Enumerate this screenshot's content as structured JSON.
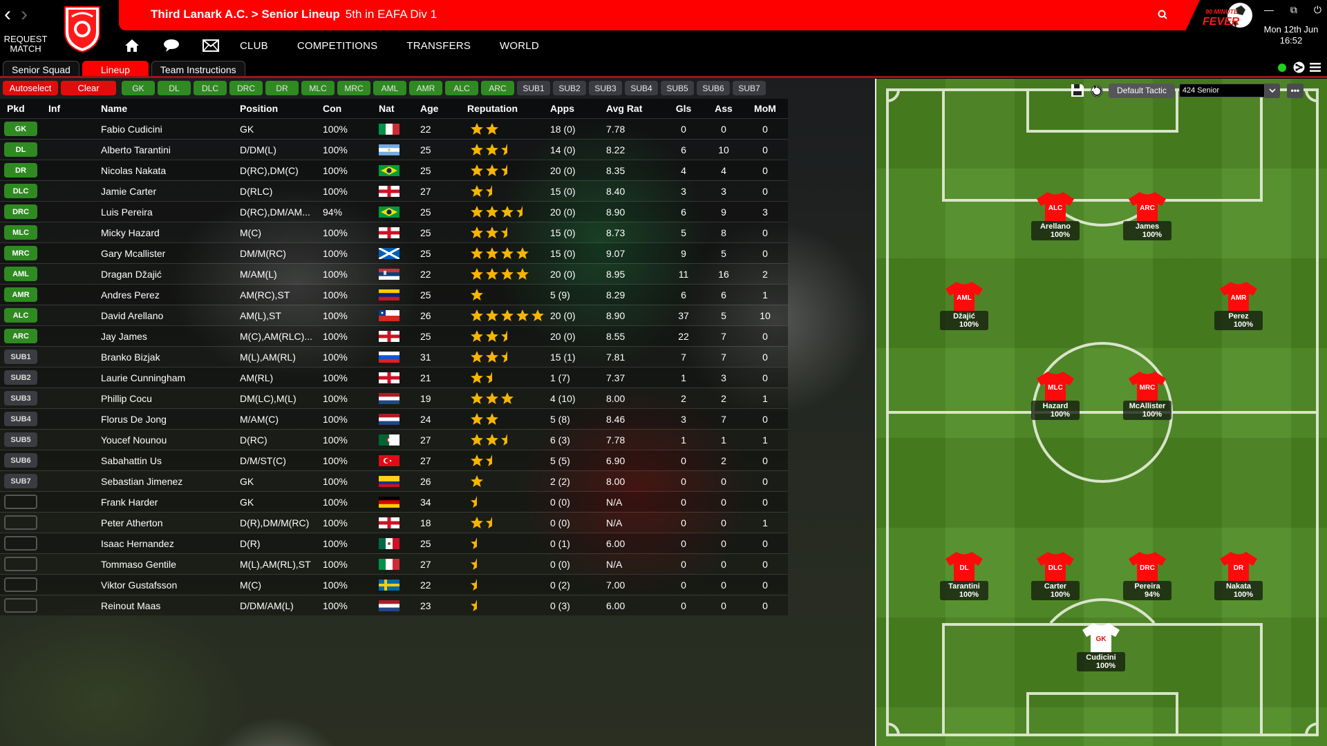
{
  "window": {
    "title_path": "Third Lanark A.C. > Senior Lineup",
    "title_sub": "5th in EAFA Div 1",
    "date": "Mon 12th Jun",
    "time": "16:52",
    "request_match": "REQUEST MATCH",
    "brand": "90 MINUTE FEVER"
  },
  "main_nav": [
    "CLUB",
    "COMPETITIONS",
    "TRANSFERS",
    "WORLD"
  ],
  "sub_tabs": [
    {
      "label": "Senior Squad",
      "active": false
    },
    {
      "label": "Lineup",
      "active": true
    },
    {
      "label": "Team Instructions",
      "active": false
    }
  ],
  "actions": {
    "autoselect": "Autoselect",
    "clear": "Clear"
  },
  "position_slots": {
    "starting": [
      "GK",
      "DL",
      "DLC",
      "DRC",
      "DR",
      "MLC",
      "MRC",
      "AML",
      "AMR",
      "ALC",
      "ARC"
    ],
    "subs": [
      "SUB1",
      "SUB2",
      "SUB3",
      "SUB4",
      "SUB5",
      "SUB6",
      "SUB7"
    ]
  },
  "table": {
    "headers": [
      "Pkd",
      "Inf",
      "Name",
      "Position",
      "Con",
      "Nat",
      "Age",
      "Reputation",
      "Apps",
      "Avg Rat",
      "Gls",
      "Ass",
      "MoM"
    ],
    "rows": [
      {
        "pkd": "GK",
        "name": "Fabio Cudicini",
        "position": "GK",
        "con": "100%",
        "nat": "italy",
        "age": "22",
        "rep": 2,
        "apps": "18 (0)",
        "avg": "7.78",
        "gls": "0",
        "ass": "0",
        "mom": "0"
      },
      {
        "pkd": "DL",
        "name": "Alberto Tarantini",
        "position": "D/DM(L)",
        "con": "100%",
        "nat": "argentina",
        "age": "25",
        "rep": 2.5,
        "apps": "14 (0)",
        "avg": "8.22",
        "gls": "6",
        "ass": "10",
        "mom": "0"
      },
      {
        "pkd": "DR",
        "name": "Nicolas Nakata",
        "position": "D(RC),DM(C)",
        "con": "100%",
        "nat": "brazil",
        "age": "25",
        "rep": 2.5,
        "apps": "20 (0)",
        "avg": "8.35",
        "gls": "4",
        "ass": "4",
        "mom": "0"
      },
      {
        "pkd": "DLC",
        "name": "Jamie Carter",
        "position": "D(RLC)",
        "con": "100%",
        "nat": "england",
        "age": "27",
        "rep": 1.5,
        "apps": "15 (0)",
        "avg": "8.40",
        "gls": "3",
        "ass": "3",
        "mom": "0"
      },
      {
        "pkd": "DRC",
        "name": "Luis Pereira",
        "position": "D(RC),DM/AM...",
        "con": "94%",
        "nat": "brazil",
        "age": "25",
        "rep": 3.5,
        "apps": "20 (0)",
        "avg": "8.90",
        "gls": "6",
        "ass": "9",
        "mom": "3"
      },
      {
        "pkd": "MLC",
        "name": "Micky Hazard",
        "position": "M(C)",
        "con": "100%",
        "nat": "england",
        "age": "25",
        "rep": 2.5,
        "apps": "15 (0)",
        "avg": "8.73",
        "gls": "5",
        "ass": "8",
        "mom": "0"
      },
      {
        "pkd": "MRC",
        "name": "Gary Mcallister",
        "position": "DM/M(RC)",
        "con": "100%",
        "nat": "scotland",
        "age": "25",
        "rep": 4,
        "apps": "15 (0)",
        "avg": "9.07",
        "gls": "9",
        "ass": "5",
        "mom": "0"
      },
      {
        "pkd": "AML",
        "name": "Dragan Džajić",
        "position": "M/AM(L)",
        "con": "100%",
        "nat": "serbia",
        "age": "22",
        "rep": 4,
        "apps": "20 (0)",
        "avg": "8.95",
        "gls": "11",
        "ass": "16",
        "mom": "2"
      },
      {
        "pkd": "AMR",
        "name": "Andres Perez",
        "position": "AM(RC),ST",
        "con": "100%",
        "nat": "venezuela",
        "age": "25",
        "rep": 1,
        "apps": "5 (9)",
        "avg": "8.29",
        "gls": "6",
        "ass": "6",
        "mom": "1"
      },
      {
        "pkd": "ALC",
        "name": "David Arellano",
        "position": "AM(L),ST",
        "con": "100%",
        "nat": "chile",
        "age": "26",
        "rep": 5,
        "apps": "20 (0)",
        "avg": "8.90",
        "gls": "37",
        "ass": "5",
        "mom": "10"
      },
      {
        "pkd": "ARC",
        "name": "Jay James",
        "position": "M(C),AM(RLC)...",
        "con": "100%",
        "nat": "england",
        "age": "25",
        "rep": 2.5,
        "apps": "20 (0)",
        "avg": "8.55",
        "gls": "22",
        "ass": "7",
        "mom": "0"
      },
      {
        "pkd": "SUB1",
        "name": "Branko Bizjak",
        "position": "M(L),AM(RL)",
        "con": "100%",
        "nat": "slovenia",
        "age": "31",
        "rep": 2.5,
        "apps": "15 (1)",
        "avg": "7.81",
        "gls": "7",
        "ass": "7",
        "mom": "0"
      },
      {
        "pkd": "SUB2",
        "name": "Laurie Cunningham",
        "position": "AM(RL)",
        "con": "100%",
        "nat": "england",
        "age": "21",
        "rep": 1.5,
        "apps": "1 (7)",
        "avg": "7.37",
        "gls": "1",
        "ass": "3",
        "mom": "0"
      },
      {
        "pkd": "SUB3",
        "name": "Phillip Cocu",
        "position": "DM(LC),M(L)",
        "con": "100%",
        "nat": "netherlands",
        "age": "19",
        "rep": 3,
        "apps": "4 (10)",
        "avg": "8.00",
        "gls": "2",
        "ass": "2",
        "mom": "1"
      },
      {
        "pkd": "SUB4",
        "name": "Florus De Jong",
        "position": "M/AM(C)",
        "con": "100%",
        "nat": "netherlands",
        "age": "24",
        "rep": 2,
        "apps": "5 (8)",
        "avg": "8.46",
        "gls": "3",
        "ass": "7",
        "mom": "0"
      },
      {
        "pkd": "SUB5",
        "name": "Youcef Nounou",
        "position": "D(RC)",
        "con": "100%",
        "nat": "algeria",
        "age": "27",
        "rep": 2.5,
        "apps": "6 (3)",
        "avg": "7.78",
        "gls": "1",
        "ass": "1",
        "mom": "1"
      },
      {
        "pkd": "SUB6",
        "name": "Sabahattin Us",
        "position": "D/M/ST(C)",
        "con": "100%",
        "nat": "turkey",
        "age": "27",
        "rep": 1.5,
        "apps": "5 (5)",
        "avg": "6.90",
        "gls": "0",
        "ass": "2",
        "mom": "0"
      },
      {
        "pkd": "SUB7",
        "name": "Sebastian Jimenez",
        "position": "GK",
        "con": "100%",
        "nat": "colombia",
        "age": "26",
        "rep": 1,
        "apps": "2 (2)",
        "avg": "8.00",
        "gls": "0",
        "ass": "0",
        "mom": "0"
      },
      {
        "pkd": "",
        "name": "Frank Harder",
        "position": "GK",
        "con": "100%",
        "nat": "germany",
        "age": "34",
        "rep": 0.5,
        "apps": "0 (0)",
        "avg": "N/A",
        "gls": "0",
        "ass": "0",
        "mom": "0"
      },
      {
        "pkd": "",
        "name": "Peter Atherton",
        "position": "D(R),DM/M(RC)",
        "con": "100%",
        "nat": "england",
        "age": "18",
        "rep": 1.5,
        "apps": "0 (0)",
        "avg": "N/A",
        "gls": "0",
        "ass": "0",
        "mom": "1"
      },
      {
        "pkd": "",
        "name": "Isaac Hernandez",
        "position": "D(R)",
        "con": "100%",
        "nat": "mexico",
        "age": "25",
        "rep": 0.5,
        "apps": "0 (1)",
        "avg": "6.00",
        "gls": "0",
        "ass": "0",
        "mom": "0"
      },
      {
        "pkd": "",
        "name": "Tommaso Gentile",
        "position": "M(L),AM(RL),ST",
        "con": "100%",
        "nat": "italy",
        "age": "27",
        "rep": 0.5,
        "apps": "0 (0)",
        "avg": "N/A",
        "gls": "0",
        "ass": "0",
        "mom": "0"
      },
      {
        "pkd": "",
        "name": "Viktor Gustafsson",
        "position": "M(C)",
        "con": "100%",
        "nat": "sweden",
        "age": "22",
        "rep": 0.5,
        "apps": "0 (2)",
        "avg": "7.00",
        "gls": "0",
        "ass": "0",
        "mom": "0"
      },
      {
        "pkd": "",
        "name": "Reinout Maas",
        "position": "D/DM/AM(L)",
        "con": "100%",
        "nat": "netherlands",
        "age": "23",
        "rep": 0.5,
        "apps": "0 (3)",
        "avg": "6.00",
        "gls": "0",
        "ass": "0",
        "mom": "0"
      }
    ]
  },
  "tactic": {
    "default_label": "Default Tactic",
    "selected": "424 Senior"
  },
  "pitch_players": [
    {
      "slot": "ALC",
      "name": "Arellano",
      "pct": "100%"
    },
    {
      "slot": "ARC",
      "name": "James",
      "pct": "100%"
    },
    {
      "slot": "AML",
      "name": "Džajić",
      "pct": "100%"
    },
    {
      "slot": "AMR",
      "name": "Perez",
      "pct": "100%"
    },
    {
      "slot": "MLC",
      "name": "Hazard",
      "pct": "100%"
    },
    {
      "slot": "MRC",
      "name": "McAllister",
      "pct": "100%"
    },
    {
      "slot": "DL",
      "name": "Tarantini",
      "pct": "100%"
    },
    {
      "slot": "DLC",
      "name": "Carter",
      "pct": "100%"
    },
    {
      "slot": "DRC",
      "name": "Pereira",
      "pct": "94%"
    },
    {
      "slot": "DR",
      "name": "Nakata",
      "pct": "100%"
    },
    {
      "slot": "GK",
      "name": "Cudicini",
      "pct": "100%"
    }
  ],
  "colors": {
    "accent_red": "#ff0000",
    "slot_green": "#2f8a22",
    "slot_grey": "#3b3c41",
    "star_gold": "#f7b500",
    "online_green": "#1fd11f"
  }
}
